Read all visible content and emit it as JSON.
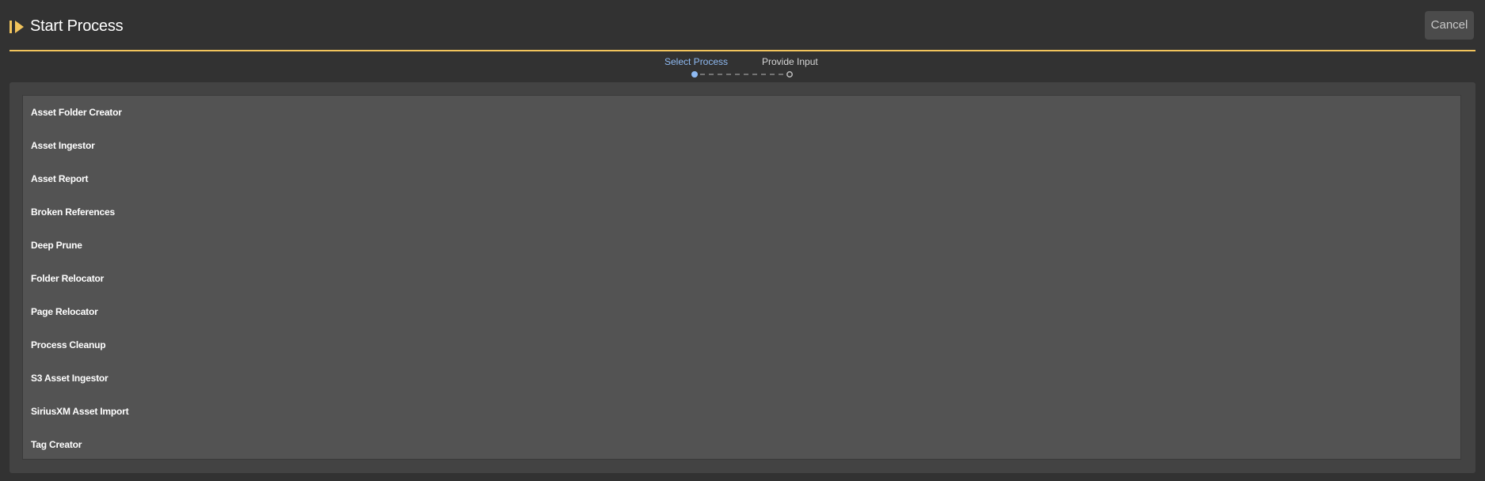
{
  "header": {
    "title": "Start Process",
    "cancel_label": "Cancel",
    "icon": "play-step-icon",
    "accent_color": "#f2c45c"
  },
  "wizard": {
    "steps": [
      {
        "label": "Select Process",
        "state": "active"
      },
      {
        "label": "Provide Input",
        "state": "pending"
      }
    ],
    "active_color": "#8fbaf2"
  },
  "process_list": {
    "items": [
      "Asset Folder Creator",
      "Asset Ingestor",
      "Asset Report",
      "Broken References",
      "Deep Prune",
      "Folder Relocator",
      "Page Relocator",
      "Process Cleanup",
      "S3 Asset Ingestor",
      "SiriusXM Asset Import",
      "Tag Creator"
    ]
  }
}
